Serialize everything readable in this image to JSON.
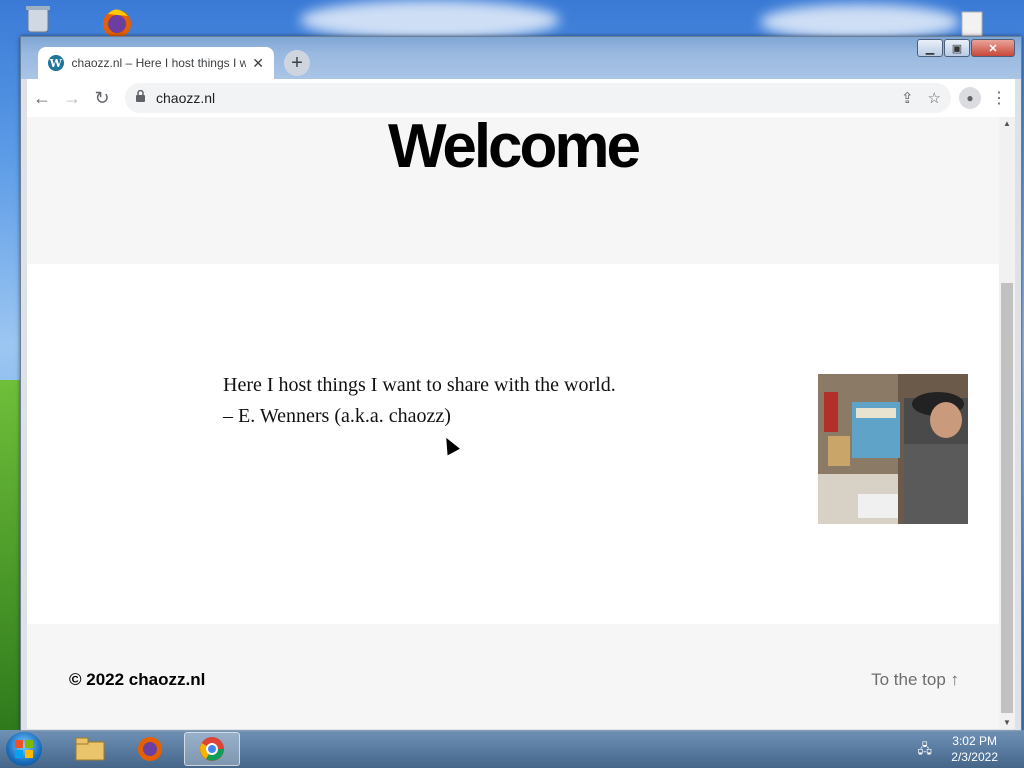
{
  "browser": {
    "tab_title": "chaozz.nl – Here I host things I w",
    "tab_favicon": "wordpress-icon",
    "url": "chaozz.nl"
  },
  "page": {
    "heading": "Welcome",
    "quote_line1": "Here I host things I want to share with the world.",
    "quote_line2": "– E. Wenners (a.k.a. chaozz)",
    "footer_copyright": "© 2022 chaozz.nl",
    "footer_totop": "To the top ↑"
  },
  "taskbar": {
    "apps": [
      "file-explorer-icon",
      "firefox-icon",
      "chrome-icon"
    ],
    "active_app": "chrome",
    "time": "3:02 PM",
    "date": "2/3/2022"
  },
  "colors": {
    "accent_wordpress": "#21759b",
    "page_bg": "#f6f6f6",
    "content_bg": "#ffffff"
  }
}
